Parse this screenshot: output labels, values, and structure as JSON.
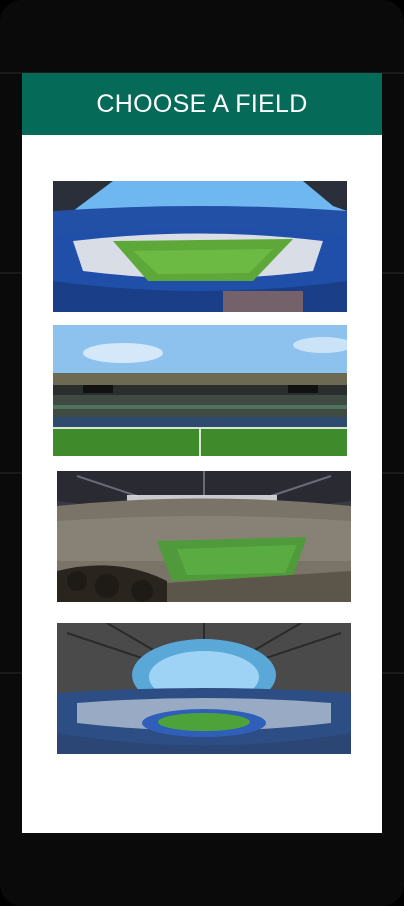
{
  "header": {
    "title": "CHOOSE A FIELD"
  },
  "fields": [
    {
      "icon": "stadium-bowl-image",
      "colors": {
        "sky": "#6fb7f0",
        "stands": "#1f4fa8",
        "pitch": "#5ea83a"
      }
    },
    {
      "icon": "stadium-side-image",
      "colors": {
        "sky": "#8ec2ee",
        "stands": "#3f4a43",
        "pitch": "#3f8a2a"
      }
    },
    {
      "icon": "stadium-night-image",
      "colors": {
        "sky": "#3a3a44",
        "stands": "#7a7468",
        "pitch": "#4f9a3a"
      }
    },
    {
      "icon": "stadium-open-roof-image",
      "colors": {
        "sky": "#9fd3f5",
        "stands": "#2c4e84",
        "pitch": "#4ea23a"
      }
    }
  ],
  "theme": {
    "header_bg": "#056b58",
    "header_text": "#ffffff",
    "screen_bg": "#ffffff",
    "device_bg": "#0a0a0a"
  }
}
